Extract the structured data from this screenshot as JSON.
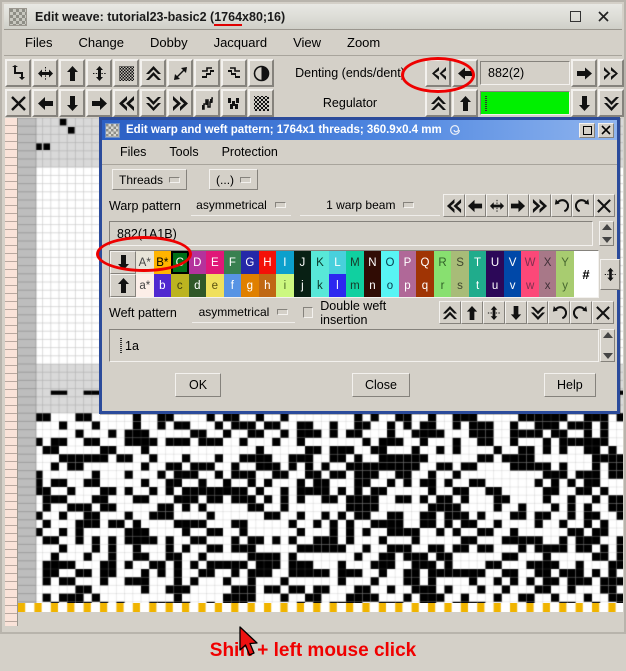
{
  "main_window": {
    "title": "Edit weave: tutorial23-basic2 (1764x80;16)",
    "title_prefix": "Edit weave: tutorial23-basic2 (",
    "title_underlined": "1764",
    "title_suffix": "x80;16)",
    "icon": "weave-pattern-icon",
    "buttons": {
      "maximize": "□",
      "close": "✕"
    },
    "menu": [
      "Files",
      "Change",
      "Dobby",
      "Jacquard",
      "View",
      "Zoom"
    ],
    "toolbar": {
      "row1_icons": [
        "rotate-icon",
        "horizontal-flip-icon",
        "arrow-up-icon",
        "vertical-stretch-icon",
        "hatch-block-icon",
        "double-arrow-up-icon",
        "diagonal-arrows-icon",
        "shift-steps-icon",
        "shift-steps2-icon",
        "contrast-icon"
      ],
      "row2_icons": [
        "close-x-icon",
        "arrow-left-icon",
        "arrow-down-icon",
        "arrow-right-icon",
        "double-arrow-left-icon",
        "double-arrow-down-icon",
        "double-arrow-right-icon",
        "twill-icon",
        "twill2-icon",
        "noise-icon"
      ],
      "denting_label": "Denting (ends/dent)",
      "denting_value": "882(2)",
      "denting_nav_left": [
        "double-arrow-left-icon",
        "arrow-left-icon"
      ],
      "denting_nav_right": [
        "arrow-right-icon",
        "double-arrow-right-icon"
      ],
      "regulator_label": "Regulator",
      "regulator_value": "",
      "regulator_nav_left": [
        "double-arrow-up-icon",
        "arrow-up-icon"
      ],
      "regulator_nav_right": [
        "arrow-down-icon",
        "double-arrow-down-icon"
      ],
      "regulator_color": "#00f000"
    }
  },
  "dialog": {
    "title": "Edit warp and weft pattern; 1764x1 threads; 360.9x0.4 mm",
    "title_icon": "weave-pattern-icon",
    "title_glyph": "spiral-icon",
    "buttons": {
      "maximize": "□",
      "close": "✕"
    },
    "menu": [
      "Files",
      "Tools",
      "Protection"
    ],
    "mode_buttons": [
      {
        "label": "Threads",
        "name": "threads-dropdown"
      },
      {
        "label": "(...)",
        "name": "ellipsis-dropdown"
      }
    ],
    "warp": {
      "label": "Warp pattern",
      "symmetry": "asymmetrical",
      "beam": "1 warp beam",
      "icons": [
        "double-arrow-left-icon",
        "arrow-left-icon",
        "horizontal-flip-icon",
        "arrow-right-icon",
        "double-arrow-right-icon",
        "undo-icon",
        "redo-icon",
        "close-x-icon"
      ]
    },
    "pattern_value": "882(1A1B)",
    "palette": {
      "up_icon": "arrow-down-icon",
      "down_icon": "arrow-up-icon",
      "hash": "#",
      "resize_icon": "vertical-resize-icon",
      "selected": "C",
      "upper": [
        {
          "label": "A*",
          "color": "#e8e4d8",
          "text": "#444444"
        },
        {
          "label": "B*",
          "color": "#ffb400",
          "text": "#000000"
        },
        {
          "label": "C",
          "color": "#007018",
          "text": "#ffffff"
        },
        {
          "label": "D",
          "color": "#b4329c",
          "text": "#ffffff"
        },
        {
          "label": "E",
          "color": "#e01878",
          "text": "#ffffff"
        },
        {
          "label": "F",
          "color": "#388050",
          "text": "#ffffff"
        },
        {
          "label": "G",
          "color": "#2428a8",
          "text": "#ffffff"
        },
        {
          "label": "H",
          "color": "#f41008",
          "text": "#ffffff"
        },
        {
          "label": "I",
          "color": "#0ca0cc",
          "text": "#ffffff"
        },
        {
          "label": "J",
          "color": "#082014",
          "text": "#ffffff"
        },
        {
          "label": "K",
          "color": "#58e8d8",
          "text": "#083828"
        },
        {
          "label": "L",
          "color": "#48d0dc",
          "text": "#ffffff"
        },
        {
          "label": "M",
          "color": "#10d0a0",
          "text": "#183828"
        },
        {
          "label": "N",
          "color": "#300c04",
          "text": "#ffffff"
        },
        {
          "label": "O",
          "color": "#58f4f4",
          "text": "#084050"
        },
        {
          "label": "P",
          "color": "#b06898",
          "text": "#ffffff"
        },
        {
          "label": "Q",
          "color": "#a03404",
          "text": "#ffffff"
        },
        {
          "label": "R",
          "color": "#88e070",
          "text": "#306028"
        },
        {
          "label": "S",
          "color": "#a8bc78",
          "text": "#404830"
        },
        {
          "label": "T",
          "color": "#20ac8c",
          "text": "#ffffff"
        },
        {
          "label": "U",
          "color": "#2c0858",
          "text": "#ffffff"
        },
        {
          "label": "V",
          "color": "#0048a8",
          "text": "#ffffff"
        },
        {
          "label": "W",
          "color": "#fc4878",
          "text": "#803050"
        },
        {
          "label": "X",
          "color": "#a87888",
          "text": "#403038"
        },
        {
          "label": "Y",
          "color": "#a8cc70",
          "text": "#486830"
        }
      ],
      "lower": [
        {
          "label": "a*",
          "color": "#fceee8",
          "text": "#444444"
        },
        {
          "label": "b",
          "color": "#5028d0",
          "text": "#ffffff"
        },
        {
          "label": "c",
          "color": "#bcb420",
          "text": "#404010"
        },
        {
          "label": "d",
          "color": "#305828",
          "text": "#ffffff"
        },
        {
          "label": "e",
          "color": "#f0e05c",
          "text": "#585010"
        },
        {
          "label": "f",
          "color": "#5894e4",
          "text": "#ffffff"
        },
        {
          "label": "g",
          "color": "#e08000",
          "text": "#ffffff"
        },
        {
          "label": "h",
          "color": "#c06814",
          "text": "#ffffff"
        },
        {
          "label": "i",
          "color": "#ccf880",
          "text": "#507028"
        },
        {
          "label": "j",
          "color": "#082014",
          "text": "#ffffff"
        },
        {
          "label": "k",
          "color": "#58e8d8",
          "text": "#083828"
        },
        {
          "label": "l",
          "color": "#2c28f0",
          "text": "#ffffff"
        },
        {
          "label": "m",
          "color": "#10d0a0",
          "text": "#183828"
        },
        {
          "label": "n",
          "color": "#300c04",
          "text": "#ffffff"
        },
        {
          "label": "o",
          "color": "#58f4f4",
          "text": "#084050"
        },
        {
          "label": "p",
          "color": "#b06898",
          "text": "#ffffff"
        },
        {
          "label": "q",
          "color": "#a03404",
          "text": "#ffffff"
        },
        {
          "label": "r",
          "color": "#88e070",
          "text": "#306028"
        },
        {
          "label": "s",
          "color": "#a8bc78",
          "text": "#404830"
        },
        {
          "label": "t",
          "color": "#20ac8c",
          "text": "#ffffff"
        },
        {
          "label": "u",
          "color": "#2c0858",
          "text": "#ffffff"
        },
        {
          "label": "v",
          "color": "#0048a8",
          "text": "#ffffff"
        },
        {
          "label": "w",
          "color": "#fc4878",
          "text": "#803050"
        },
        {
          "label": "x",
          "color": "#a87888",
          "text": "#403038"
        },
        {
          "label": "y",
          "color": "#a8cc70",
          "text": "#486830"
        }
      ]
    },
    "weft": {
      "label": "Weft pattern",
      "symmetry": "asymmetrical",
      "checkbox_label": "Double weft insertion",
      "checkbox_checked": false,
      "icons": [
        "double-arrow-up-icon",
        "arrow-up-icon",
        "vertical-stretch-icon",
        "arrow-down-icon",
        "double-arrow-down-icon",
        "undo-icon",
        "redo-icon",
        "close-x-icon"
      ]
    },
    "entry_value": "1a",
    "footer_buttons": [
      {
        "label": "OK",
        "name": "ok-button"
      },
      {
        "label": "Close",
        "name": "close-button"
      },
      {
        "label": "Help",
        "name": "help-button"
      }
    ]
  },
  "annotations": {
    "hint_text": "Shift + left mouse click",
    "hint_color": "#f00000",
    "highlight_color": "#ee0000",
    "cursor": "mouse-pointer-icon"
  }
}
